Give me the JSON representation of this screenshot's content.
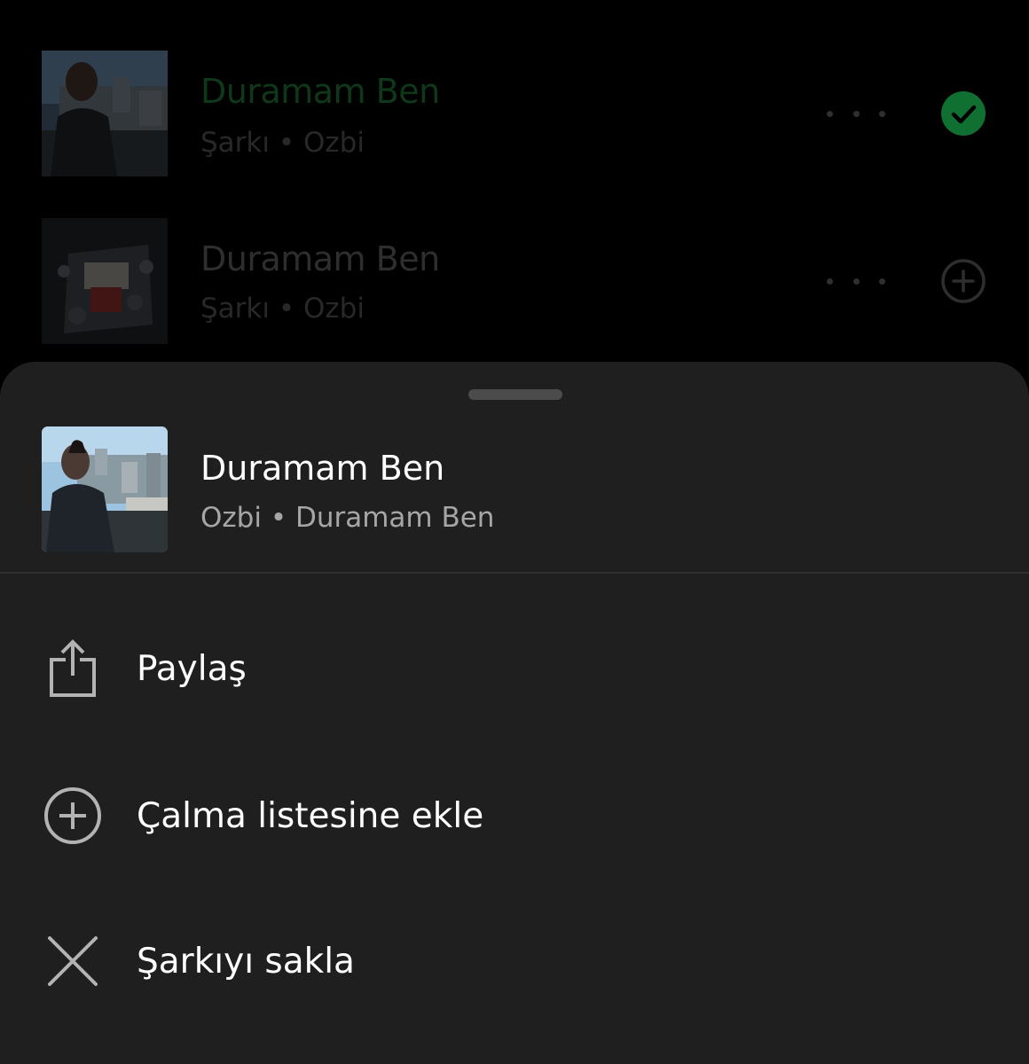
{
  "background_tracks": [
    {
      "title": "Duramam Ben",
      "subtitle": "Şarkı • Ozbi",
      "title_color": "#1c6b31",
      "state": "added",
      "state_icon": "check-circle-icon",
      "more_icon": "more-options-icon"
    },
    {
      "title": "Duramam Ben",
      "subtitle": "Şarkı • Ozbi",
      "title_color": "#595959",
      "state": "not-added",
      "state_icon": "add-circle-icon",
      "more_icon": "more-options-icon"
    }
  ],
  "sheet": {
    "track_title": "Duramam Ben",
    "track_subtitle": "Ozbi • Duramam Ben",
    "actions": [
      {
        "label": "Paylaş",
        "icon": "share-icon"
      },
      {
        "label": "Çalma listesine ekle",
        "icon": "add-circle-icon"
      },
      {
        "label": "Şarkıyı sakla",
        "icon": "close-icon"
      }
    ]
  },
  "colors": {
    "accent": "#1ed760",
    "sheet_background": "#1f1f1f"
  }
}
